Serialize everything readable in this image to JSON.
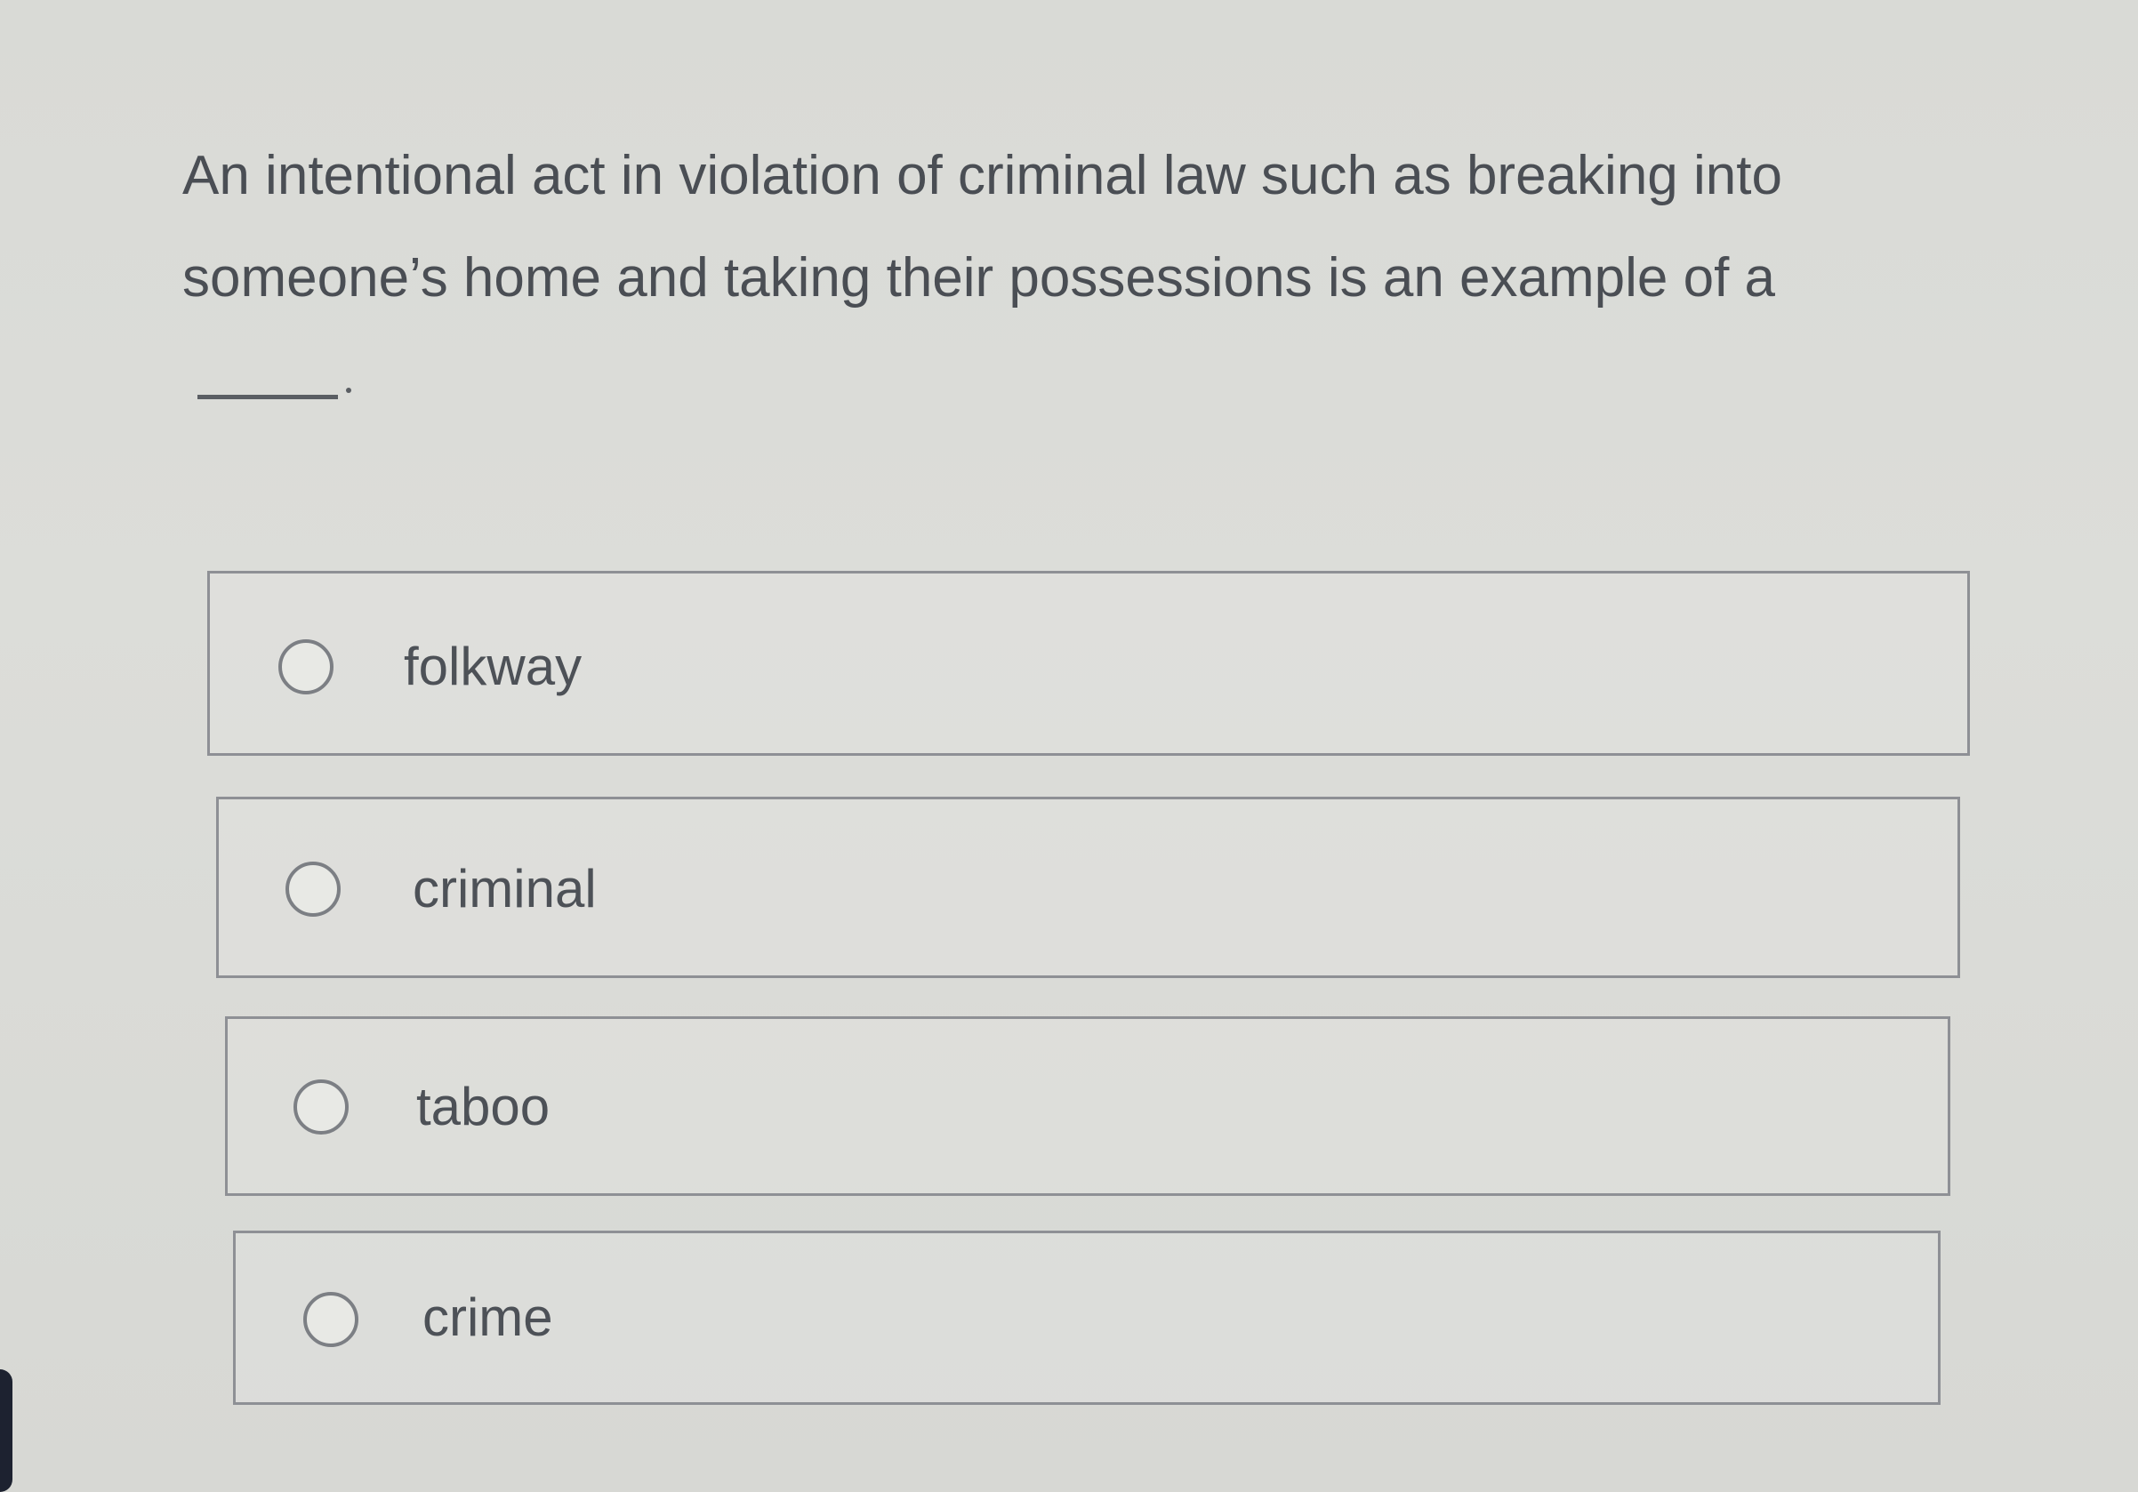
{
  "question": {
    "text": "An intentional act in violation of criminal law such as breaking into someone’s home and taking their possessions is an example of a",
    "blank": "_____."
  },
  "options": [
    {
      "label": "folkway",
      "selected": false
    },
    {
      "label": "criminal",
      "selected": false
    },
    {
      "label": "taboo",
      "selected": false
    },
    {
      "label": "crime",
      "selected": false
    }
  ]
}
